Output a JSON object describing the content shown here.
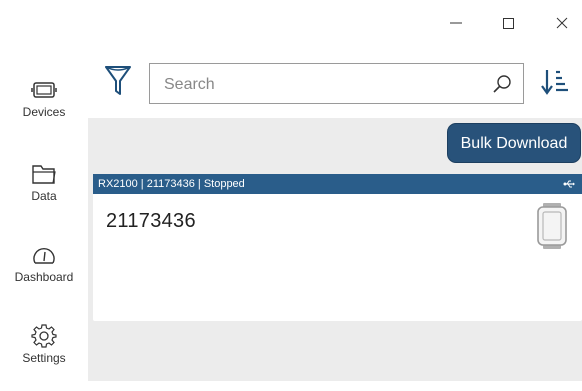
{
  "window": {
    "minimize_icon": "minimize-icon",
    "maximize_icon": "maximize-icon",
    "close_icon": "close-icon"
  },
  "nav": {
    "items": [
      {
        "label": "Devices",
        "icon": "devices-icon"
      },
      {
        "label": "Data",
        "icon": "folder-icon"
      },
      {
        "label": "Dashboard",
        "icon": "gauge-icon"
      },
      {
        "label": "Settings",
        "icon": "gear-icon"
      }
    ]
  },
  "toolbar": {
    "filter_icon": "filter-icon",
    "search_placeholder": "Search",
    "search_value": "",
    "search_icon": "search-icon",
    "sort_icon": "sort-icon"
  },
  "content": {
    "bulk_download_label": "Bulk Download",
    "device_card": {
      "header": "RX2100 | 21173436 | Stopped",
      "serial": "21173436",
      "connection_icon": "usb-icon",
      "device_icon": "logger-device-icon"
    }
  },
  "colors": {
    "accent": "#2a5d8a",
    "button": "#28527a",
    "content_bg": "#ececec"
  }
}
